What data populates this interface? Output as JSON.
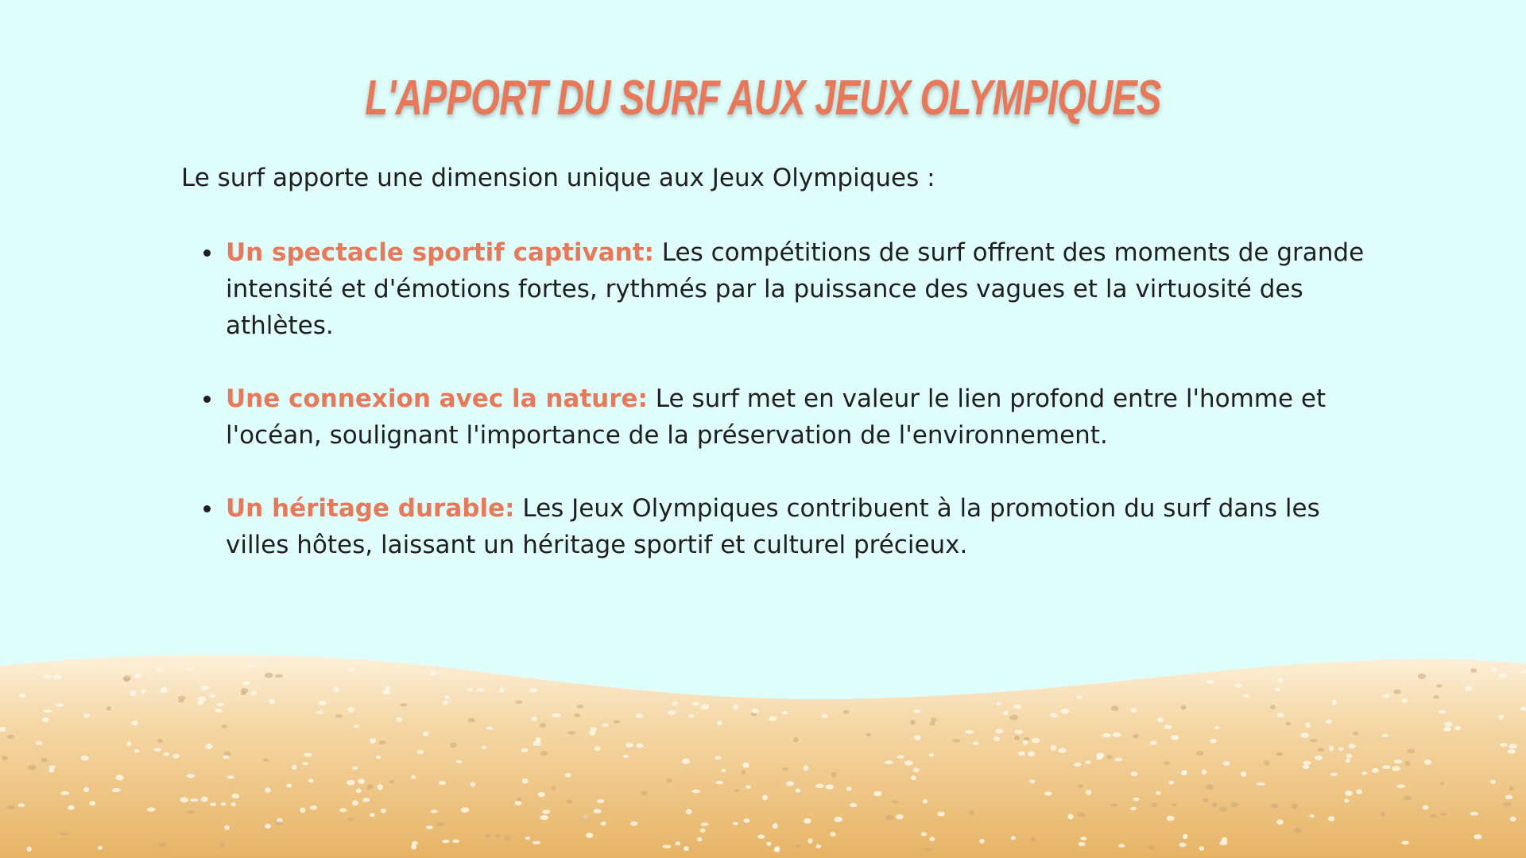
{
  "slide": {
    "title": "L'APPORT DU SURF AUX JEUX OLYMPIQUES",
    "intro": "Le surf apporte une dimension unique aux Jeux Olympiques :",
    "bullets": [
      {
        "heading": "Un spectacle sportif captivant:",
        "text": " Les compétitions de surf offrent des moments de grande intensité et d'émotions fortes, rythmés par la puissance des vagues et la virtuosité des athlètes."
      },
      {
        "heading": "Une connexion avec la nature:",
        "text": " Le surf met en valeur le lien profond entre l'homme et l'océan, soulignant l'importance de la préservation de l'environnement."
      },
      {
        "heading": "Un héritage durable:",
        "text": " Les Jeux Olympiques contribuent à la promotion du surf dans les villes hôtes, laissant un héritage sportif et culturel précieux."
      }
    ]
  },
  "colors": {
    "background": "#defdfb",
    "accent": "#e8785a",
    "text": "#1f1f1f",
    "sand_light": "#fbe6c6",
    "sand_dark": "#e8b86e"
  }
}
